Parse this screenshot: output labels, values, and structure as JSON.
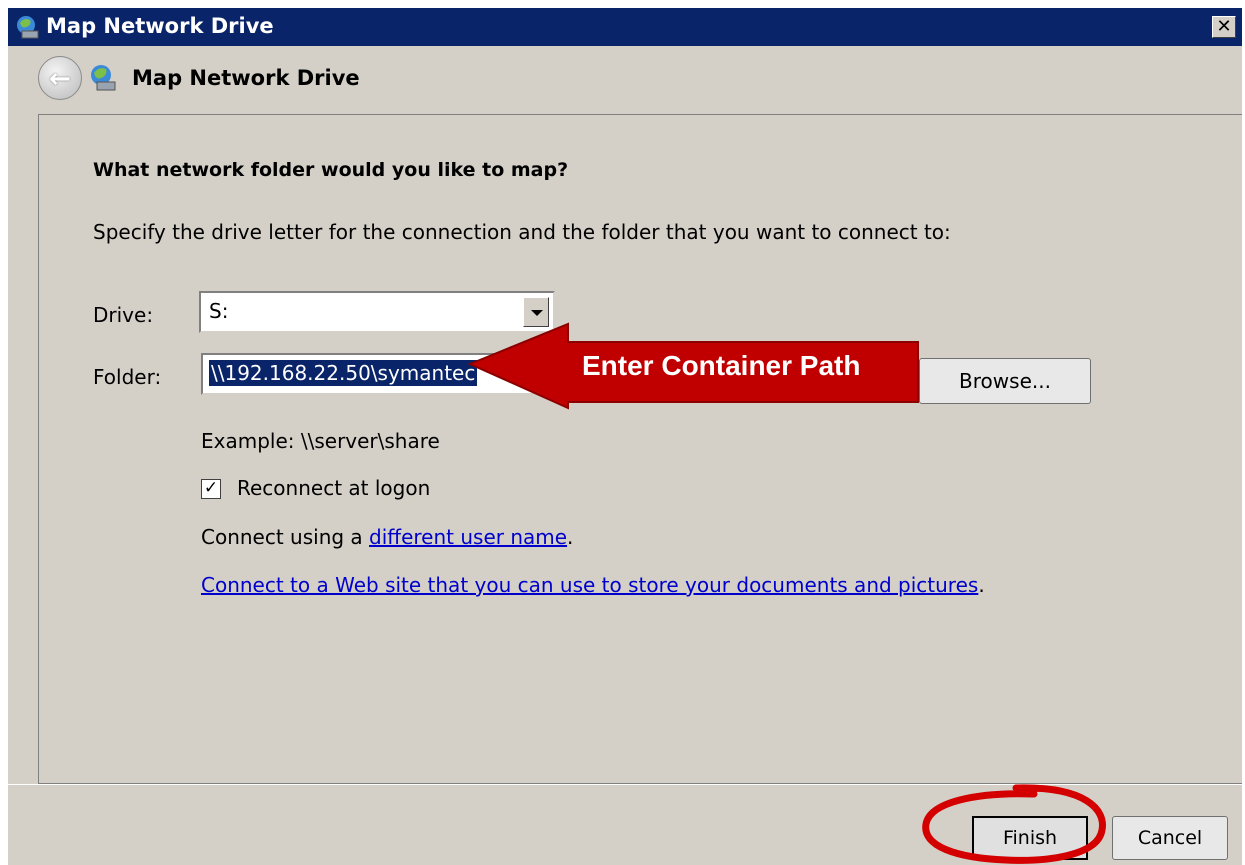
{
  "window": {
    "title": "Map Network Drive",
    "close_glyph": "✕"
  },
  "nav": {
    "title": "Map Network Drive"
  },
  "content": {
    "heading": "What network folder would you like to map?",
    "description": "Specify the drive letter for the connection and the folder that you want to connect to:",
    "drive_label": "Drive:",
    "drive_value": "S:",
    "folder_label": "Folder:",
    "folder_value": "\\\\192.168.22.50\\symantec",
    "browse_label": "Browse...",
    "example": "Example: \\\\server\\share",
    "reconnect_label": "Reconnect at logon",
    "reconnect_checked": true,
    "connect_prefix": "Connect using a ",
    "connect_link": "different user name",
    "connect_suffix": ".",
    "website_link": "Connect to a Web site that you can use to store your documents and pictures",
    "website_suffix": "."
  },
  "annotation": {
    "arrow_text": "Enter Container Path",
    "arrow_color": "#c00000",
    "circle_color": "#d40000"
  },
  "footer": {
    "finish_label": "Finish",
    "cancel_label": "Cancel"
  },
  "icons": {
    "title": "network-drive-icon",
    "back": "back-arrow-icon",
    "nav": "network-drive-icon",
    "dropdown": "chevron-down-icon",
    "check": "checkmark-icon"
  },
  "colors": {
    "titlebar": "#0a246a",
    "dialog_bg": "#d4d0c8",
    "link": "#0000cc",
    "selection": "#0a246a"
  }
}
